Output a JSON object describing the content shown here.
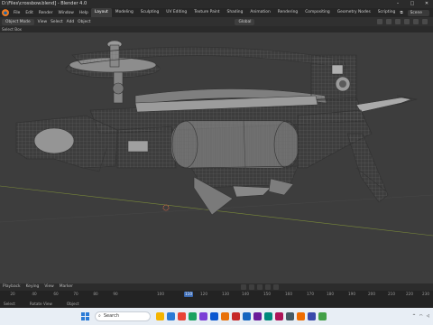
{
  "window": {
    "title": "D:\\Files\\crossbow.blend] - Blender 4.0",
    "controls": [
      "–",
      "□",
      "✕"
    ]
  },
  "menubar": {
    "menus": [
      "File",
      "Edit",
      "Render",
      "Window",
      "Help"
    ],
    "tabs": [
      "Layout",
      "Modeling",
      "Sculpting",
      "UV Editing",
      "Texture Paint",
      "Shading",
      "Animation",
      "Rendering",
      "Compositing",
      "Geometry Nodes",
      "Scripting"
    ],
    "active_tab": "Layout",
    "scene_label": "Scene"
  },
  "header": {
    "mode": "Object Mode",
    "items": [
      "View",
      "Select",
      "Add",
      "Object"
    ],
    "orientation": "Global"
  },
  "subheader": {
    "text": "Select Box"
  },
  "timeline": {
    "labels": [
      "Playback",
      "Keying",
      "View",
      "Marker"
    ],
    "current_frame": "110",
    "ticks": [
      "20",
      "40",
      "60",
      "70",
      "80",
      "90",
      "100",
      "110",
      "120",
      "130",
      "140",
      "150",
      "160",
      "170",
      "180",
      "190",
      "200",
      "210",
      "220",
      "230"
    ]
  },
  "statusbar": {
    "items": [
      "Select",
      "Rotate View",
      "Object"
    ]
  },
  "taskbar": {
    "search_placeholder": "Search",
    "time": "",
    "colors": [
      "#f4b400",
      "#2b7bd6",
      "#e94335",
      "#1aa260",
      "#7b3fd6",
      "#0b57d0",
      "#e8710a",
      "#c62828",
      "#1565c0",
      "#6a1b9a",
      "#00897b",
      "#ad1457",
      "#455a64",
      "#ef6c00",
      "#3949ab",
      "#43a047"
    ]
  }
}
